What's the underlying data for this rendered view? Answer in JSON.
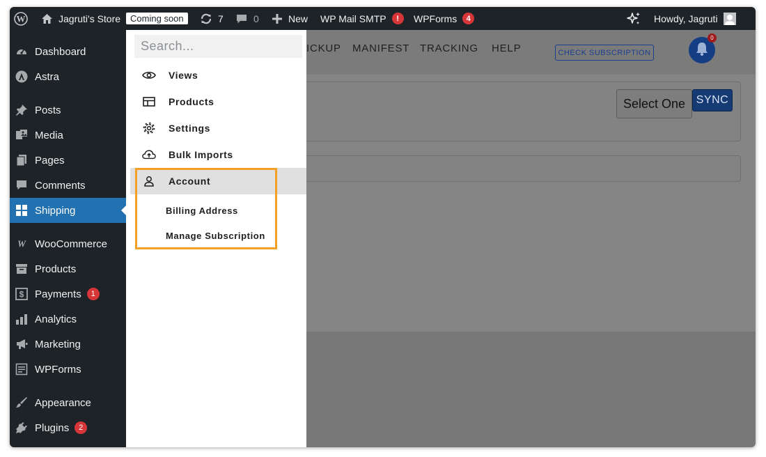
{
  "admin_bar": {
    "site_name": "Jagruti's Store",
    "coming_soon": "Coming soon",
    "updates_count": "7",
    "comments_count": "0",
    "new_label": "New",
    "wp_mail_smtp": "WP Mail SMTP",
    "wp_mail_smtp_badge": "!",
    "wpforms": "WPForms",
    "wpforms_badge": "4",
    "howdy": "Howdy, Jagruti"
  },
  "sidebar": {
    "items": [
      {
        "label": "Dashboard",
        "icon": "dashboard-icon"
      },
      {
        "label": "Astra",
        "icon": "astra-icon"
      },
      {
        "label": "Posts",
        "icon": "pin-icon"
      },
      {
        "label": "Media",
        "icon": "media-icon"
      },
      {
        "label": "Pages",
        "icon": "pages-icon"
      },
      {
        "label": "Comments",
        "icon": "comment-icon"
      },
      {
        "label": "Shipping",
        "icon": "grid-icon",
        "active": true
      },
      {
        "label": "WooCommerce",
        "icon": "woocommerce-icon"
      },
      {
        "label": "Products",
        "icon": "archive-icon"
      },
      {
        "label": "Payments",
        "icon": "payments-icon",
        "badge": "1"
      },
      {
        "label": "Analytics",
        "icon": "bar-chart-icon"
      },
      {
        "label": "Marketing",
        "icon": "megaphone-icon"
      },
      {
        "label": "WPForms",
        "icon": "form-icon"
      },
      {
        "label": "Appearance",
        "icon": "brush-icon"
      },
      {
        "label": "Plugins",
        "icon": "plug-icon",
        "badge": "2"
      }
    ]
  },
  "dropdown": {
    "search_placeholder": "Search...",
    "items": [
      {
        "label": "Views",
        "icon": "eye-icon"
      },
      {
        "label": "Products",
        "icon": "table-icon"
      },
      {
        "label": "Settings",
        "icon": "gear-icon"
      },
      {
        "label": "Bulk Imports",
        "icon": "cloud-upload-icon"
      },
      {
        "label": "Account",
        "icon": "user-icon",
        "highlighted": true
      }
    ],
    "account_submenu": [
      "Billing Address",
      "Manage Subscription"
    ]
  },
  "content": {
    "tabs": [
      "ICKUP",
      "MANIFEST",
      "TRACKING",
      "HELP"
    ],
    "check_subscription": "CHECK SUBSCRIPTION",
    "notification_count": "0",
    "select_label": "Select One",
    "sync_label": "SYNC"
  },
  "colors": {
    "admin_bg": "#1d2327",
    "active_menu": "#2271b1",
    "badge_red": "#d63638",
    "highlight_border": "#f2a126"
  }
}
